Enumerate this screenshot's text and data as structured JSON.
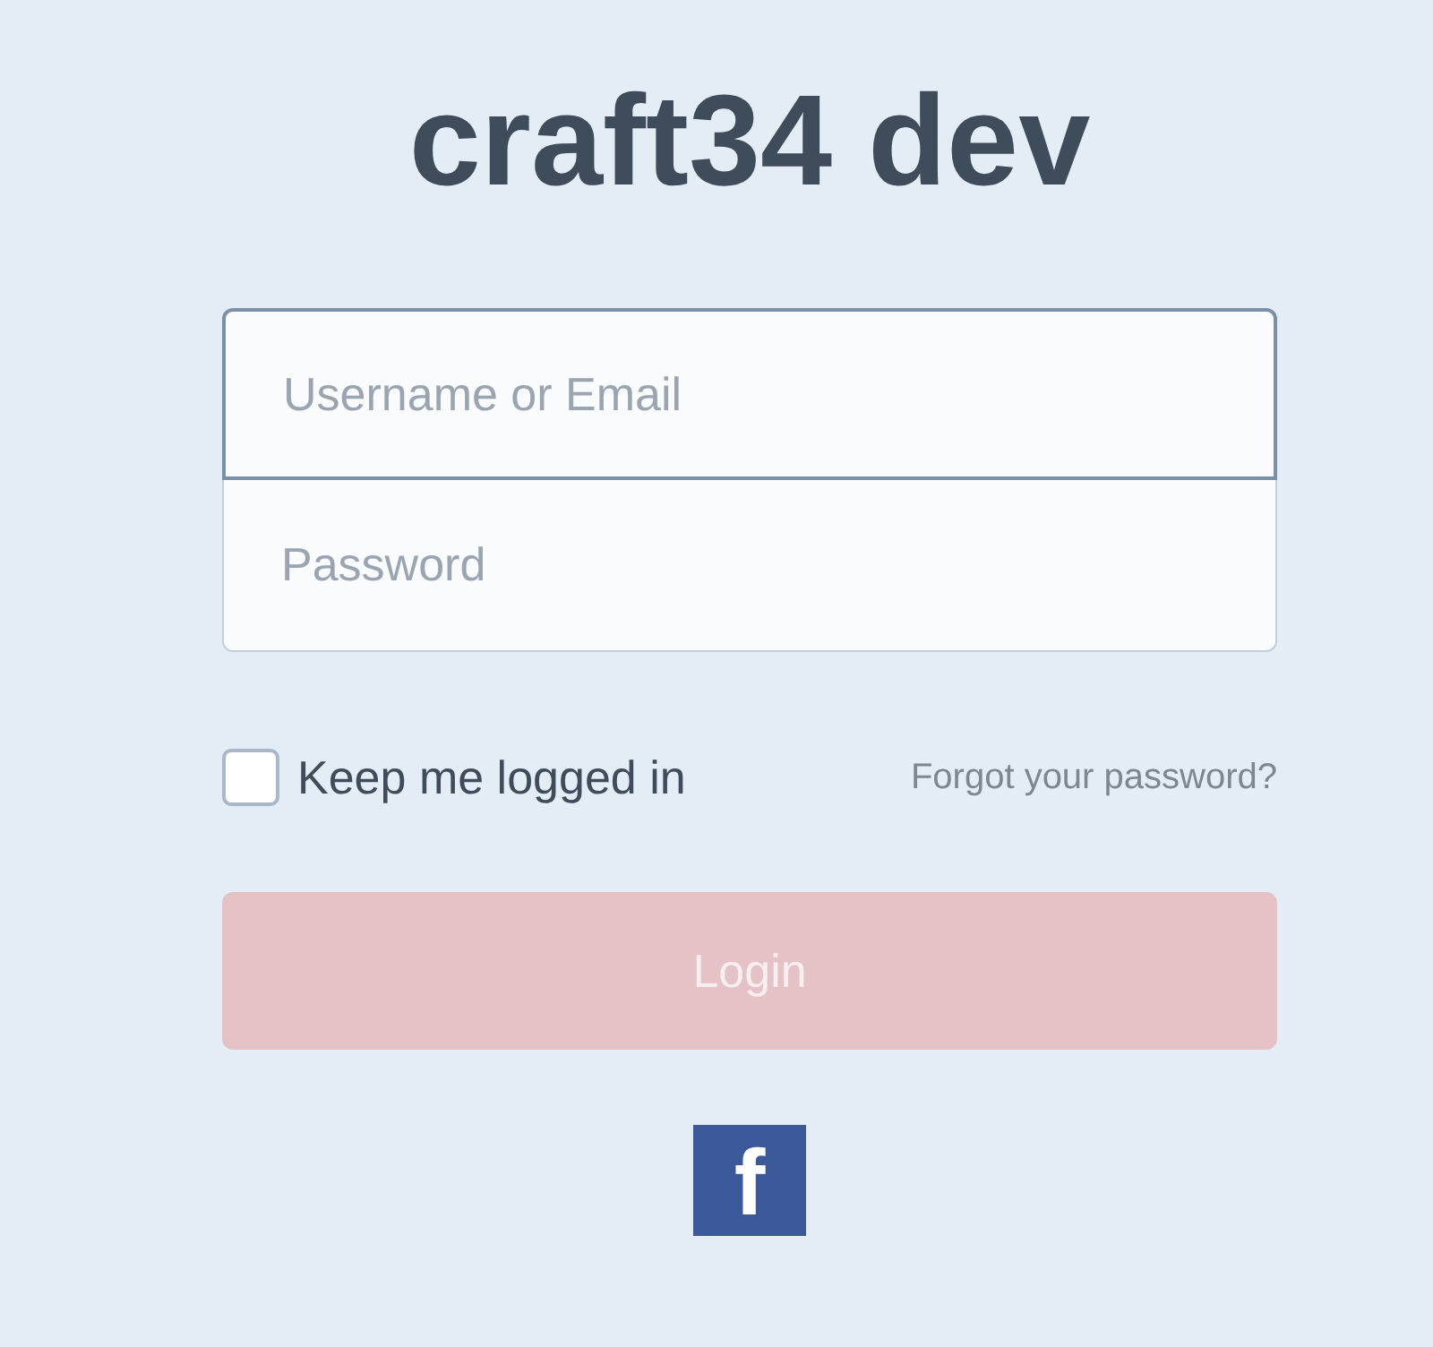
{
  "title": "craft34 dev",
  "fields": [
    {
      "placeholder": "Username or Email",
      "focused": true
    },
    {
      "placeholder": "Password",
      "focused": false
    }
  ],
  "remember": {
    "label": "Keep me logged in",
    "checked": false
  },
  "forgot_link": "Forgot your password?",
  "login_button": {
    "label": "Login",
    "disabled": true
  },
  "social": [
    {
      "kind": "facebook",
      "label": "f"
    }
  ]
}
